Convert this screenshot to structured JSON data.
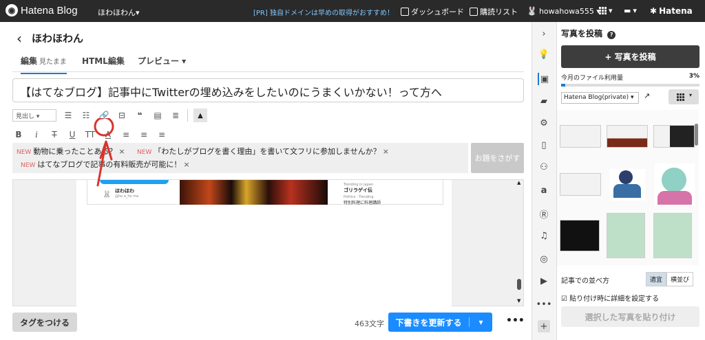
{
  "topbar": {
    "logo_text": "Hatena Blog",
    "blog_name": "ほわほわん▾",
    "promo": "[PR] 独自ドメインは早めの取得がおすすめ！",
    "dashboard": "ダッシュボード",
    "reading_list": "購読リスト",
    "user": "howahowa555 ▾",
    "hatena": "Hatena"
  },
  "editor": {
    "back_icon": "‹",
    "blog_title": "ほわほわん",
    "tabs": [
      {
        "label": "編集",
        "sub": "見たまま"
      },
      {
        "label": "HTML編集"
      },
      {
        "label": "プレビュー ▾"
      }
    ],
    "post_title": "【はてなブログ】記事中にTwitterの埋め込みをしたいのにうまくいかない！って方へ",
    "heading_select": "見出し",
    "themes": [
      {
        "badge": "NEW",
        "text": "動物に乗ったことある？"
      },
      {
        "badge": "NEW",
        "text": "「わたしがブログを書く理由」を書いて文フリに参加しませんか？"
      },
      {
        "badge": "NEW",
        "text": "はてなブログで記事の有料販売が可能に！"
      }
    ],
    "close_mark": "×",
    "find_theme": "お題をさがす",
    "embed": {
      "tweet_user": "ほわほわ",
      "tweet_handle": "@ho a_ho ma",
      "trend1_label": "Trending in Japan",
      "trend1_title": "ゴリラゲイ伝",
      "trend2_label": "Politics · Trending",
      "trend2_title": "特別料理に料理講師"
    },
    "tag_button": "タグをつける",
    "char_count": "463文字",
    "save_button": "下書きを更新する",
    "more": "•••"
  },
  "right_panel": {
    "title": "写真を投稿",
    "help": "?",
    "post_button": "+ 写真を投稿",
    "usage_label": "今月のファイル利用量",
    "usage_pct": "3%",
    "usage_fraction": 0.03,
    "album": "Hatena Blog(private) ▾",
    "sort_label": "記事での並べ方",
    "sort_options": [
      "適宜",
      "横並び"
    ],
    "checkbox_label": "貼り付け時に詳細を設定する",
    "paste_button": "選択した写真を貼り付け"
  },
  "colors": {
    "topbar": "#2a2a2a",
    "accent": "#1a8cff",
    "annotation": "#d8342c"
  }
}
